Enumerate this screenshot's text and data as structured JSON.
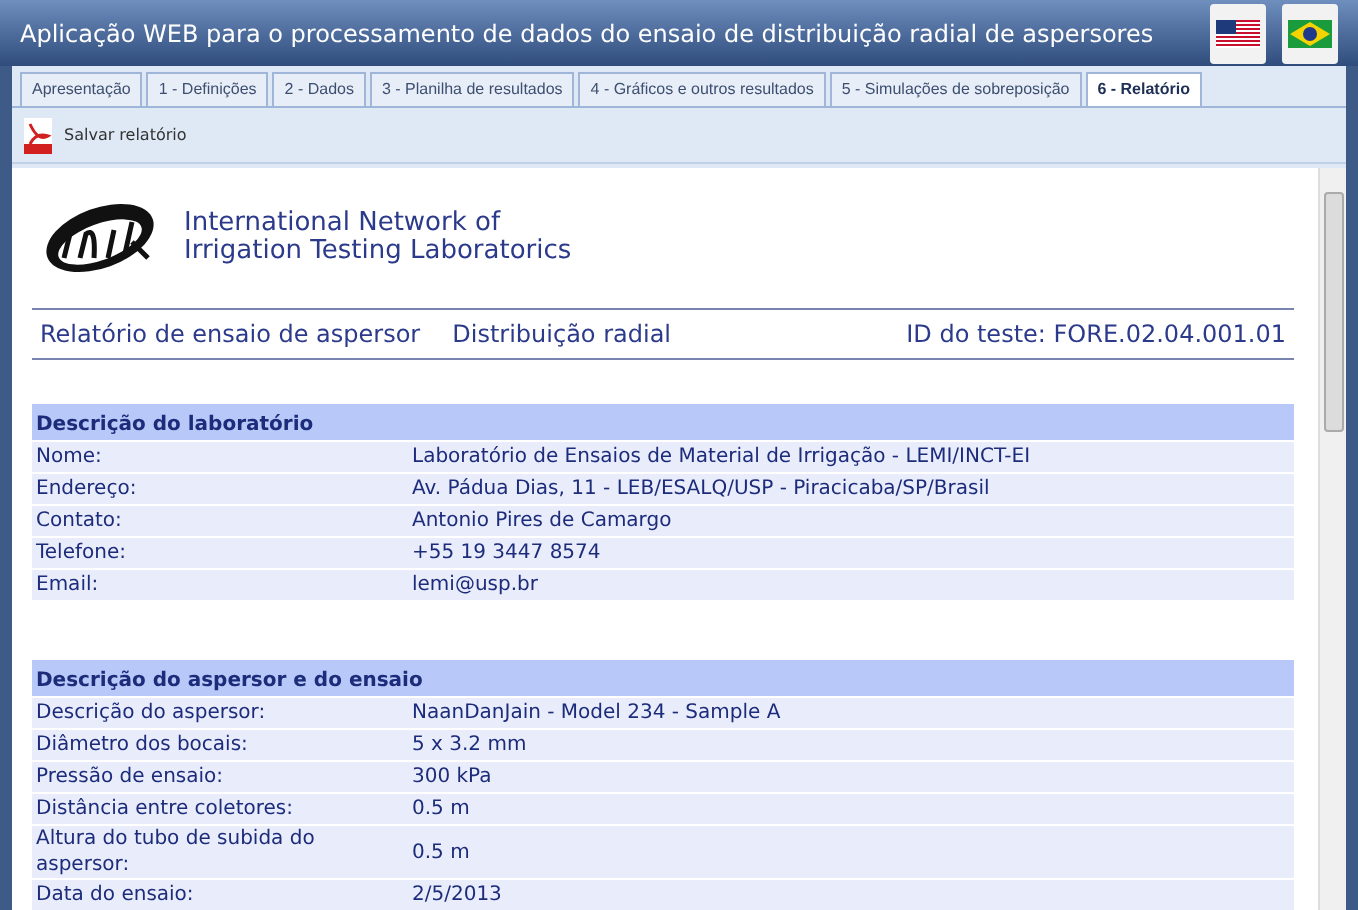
{
  "window": {
    "title": "Aplicação WEB para o processamento de dados do ensaio de distribuição radial de aspersores"
  },
  "tabs": [
    {
      "label": "Apresentação",
      "selected": false
    },
    {
      "label": "1 - Definições",
      "selected": false
    },
    {
      "label": "2 - Dados",
      "selected": false
    },
    {
      "label": "3 - Planilha de resultados",
      "selected": false
    },
    {
      "label": "4 - Gráficos e outros resultados",
      "selected": false
    },
    {
      "label": "5 - Simulações de sobreposição",
      "selected": false
    },
    {
      "label": "6 - Relatório",
      "selected": true
    }
  ],
  "toolbar": {
    "save_button": "Salvar relatório"
  },
  "report": {
    "org_name": [
      "International Network of",
      "Irrigation Testing Laboratorics"
    ],
    "heading": {
      "title": "Relatório de ensaio de aspersor",
      "type": "Distribuição radial",
      "test_id": "ID do teste: FORE.02.04.001.01"
    },
    "sections": [
      {
        "title": "Descrição do laboratório",
        "rows": [
          {
            "label": "Nome:",
            "value": "Laboratório de Ensaios de Material de Irrigação - LEMI/INCT-EI"
          },
          {
            "label": "Endereço:",
            "value": "Av. Pádua Dias, 11 - LEB/ESALQ/USP - Piracicaba/SP/Brasil"
          },
          {
            "label": "Contato:",
            "value": "Antonio Pires de Camargo"
          },
          {
            "label": "Telefone:",
            "value": "+55 19 3447 8574"
          },
          {
            "label": "Email:",
            "value": "lemi@usp.br"
          }
        ]
      },
      {
        "title": "Descrição do aspersor e do ensaio",
        "rows": [
          {
            "label": "Descrição do aspersor:",
            "value": "NaanDanJain - Model 234 - Sample A"
          },
          {
            "label": "Diâmetro dos bocais:",
            "value": "5 x 3.2 mm"
          },
          {
            "label": "Pressão de ensaio:",
            "value": "300 kPa"
          },
          {
            "label": "Distância entre coletores:",
            "value": "0.5 m"
          },
          {
            "label": "Altura do tubo de subida do aspersor:",
            "value": "0.5 m"
          },
          {
            "label": "Data do ensaio:",
            "value": "2/5/2013"
          }
        ]
      }
    ]
  }
}
